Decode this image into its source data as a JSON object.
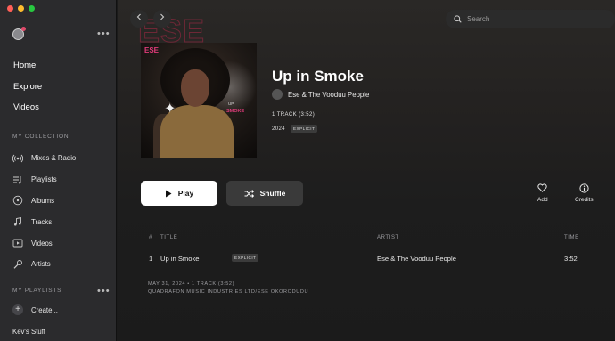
{
  "sidebar": {
    "nav": [
      {
        "label": "Home"
      },
      {
        "label": "Explore"
      },
      {
        "label": "Videos"
      }
    ],
    "collection_title": "MY COLLECTION",
    "collection": [
      {
        "label": "Mixes & Radio",
        "icon": "radio-icon"
      },
      {
        "label": "Playlists",
        "icon": "playlist-icon"
      },
      {
        "label": "Albums",
        "icon": "album-icon"
      },
      {
        "label": "Tracks",
        "icon": "music-note-icon"
      },
      {
        "label": "Videos",
        "icon": "video-icon"
      },
      {
        "label": "Artists",
        "icon": "microphone-icon"
      }
    ],
    "playlists_title": "MY PLAYLISTS",
    "create_label": "Create...",
    "playlist_items": [
      "Kev's Stuff"
    ]
  },
  "search": {
    "placeholder": "Search"
  },
  "album": {
    "title": "Up in Smoke",
    "artist": "Ese & The Vooduu People",
    "track_info": "1 TRACK  (3:52)",
    "year": "2024",
    "explicit_badge": "EXPLICIT",
    "cover_text": {
      "top": "ESE",
      "up": "UP",
      "smoke": "SMOKE"
    }
  },
  "actions": {
    "play_label": "Play",
    "shuffle_label": "Shuffle",
    "add_label": "Add",
    "credits_label": "Credits"
  },
  "table": {
    "headers": {
      "num": "#",
      "title": "TITLE",
      "artist": "ARTIST",
      "time": "TIME"
    },
    "rows": [
      {
        "num": "1",
        "title": "Up in Smoke",
        "badge": "EXPLICIT",
        "artist": "Ese & The Vooduu People",
        "time": "3:52"
      }
    ],
    "footer_line1": "MAY 31, 2024  •  1 TRACK  (3:52)",
    "footer_line2": "QUADRAFON MUSIC INDUSTRIES LTD/ESE OKORODUDU"
  },
  "colors": {
    "accent_pink": "#e03b7a",
    "sidebar_bg": "#2b2b2d",
    "main_bg": "#1b1b1b"
  }
}
